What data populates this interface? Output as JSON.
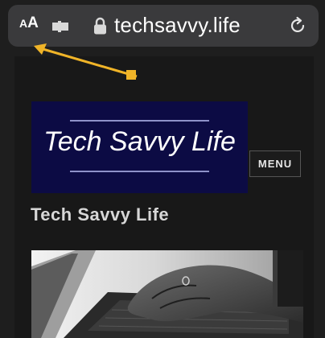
{
  "browser": {
    "text_size_small": "A",
    "text_size_large": "A",
    "url": "techsavvy.life"
  },
  "site": {
    "logo_text": "Tech Savvy Life",
    "menu_label": "MENU",
    "title": "Tech Savvy Life"
  },
  "colors": {
    "address_bar": "#3a3a3c",
    "page_background": "#181818",
    "logo_background": "#0c0b44",
    "annotation_arrow": "#f0b428"
  },
  "icons": {
    "extension": "puzzle-piece-icon",
    "lock": "lock-icon",
    "reload": "reload-icon"
  }
}
